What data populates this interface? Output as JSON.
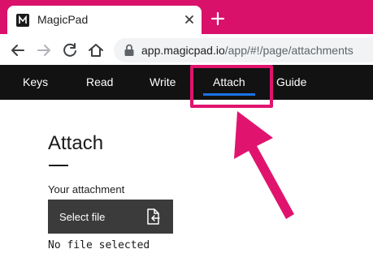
{
  "browser": {
    "tab_title": "MagicPad",
    "url_host": "app.magicpad.io",
    "url_path": "/app/#!/page/attachments"
  },
  "icons": {
    "favicon": "magicpad-logo-icon",
    "tab_close": "close-icon",
    "new_tab": "plus-icon",
    "back": "back-arrow-icon",
    "forward": "forward-arrow-icon",
    "reload": "reload-icon",
    "home": "home-icon",
    "lock": "lock-icon",
    "file_upload": "file-upload-icon"
  },
  "nav": {
    "items": [
      {
        "label": "Keys"
      },
      {
        "label": "Read"
      },
      {
        "label": "Write"
      },
      {
        "label": "Attach"
      },
      {
        "label": "Guide"
      }
    ],
    "active": "Attach"
  },
  "main": {
    "title": "Attach",
    "attachment_label": "Your attachment",
    "select_button_label": "Select file",
    "file_status": "No file selected"
  },
  "colors": {
    "tab_strip": "#d9116b",
    "nav_background": "#121212",
    "active_underline": "#1a73e8",
    "highlight": "#e0146e",
    "button_background": "#3b3b3b"
  }
}
